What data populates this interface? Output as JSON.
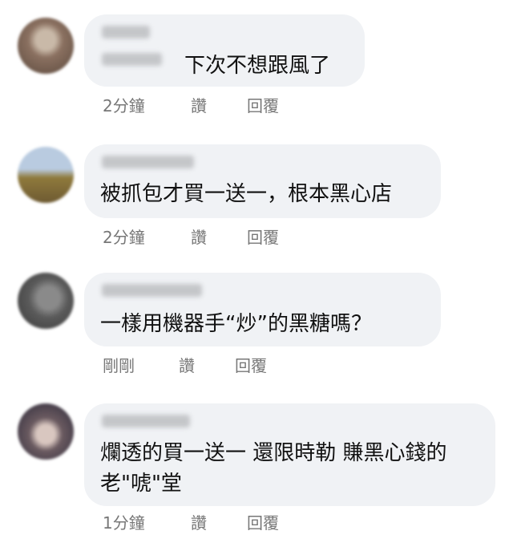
{
  "comments": [
    {
      "text_lines": [
        "下次不想跟風了"
      ],
      "time": "2分鐘",
      "like": "讚",
      "reply": "回覆",
      "avatar_colors": [
        "#8a7060",
        "#c9b9a8",
        "#5c4a3e"
      ]
    },
    {
      "text_lines": [
        "被抓包才買一送一，根本黑心店"
      ],
      "time": "2分鐘",
      "like": "讚",
      "reply": "回覆",
      "avatar_colors": [
        "#b9cbe0",
        "#6e5a32",
        "#8f7a3c"
      ]
    },
    {
      "text_lines": [
        "一樣用機器手“炒”的黑糖嗎？"
      ],
      "time": "剛剛",
      "like": "讚",
      "reply": "回覆",
      "avatar_colors": [
        "#3a3a3a",
        "#8a8a8a",
        "#5a5a5a"
      ]
    },
    {
      "text_lines": [
        "爛透的買一送一 還限時勒 賺黑心錢的",
        "老\"唬\"堂"
      ],
      "time": "1分鐘",
      "like": "讚",
      "reply": "回覆",
      "avatar_colors": [
        "#2c2a3a",
        "#d9c7c0",
        "#6a5a60"
      ]
    }
  ]
}
